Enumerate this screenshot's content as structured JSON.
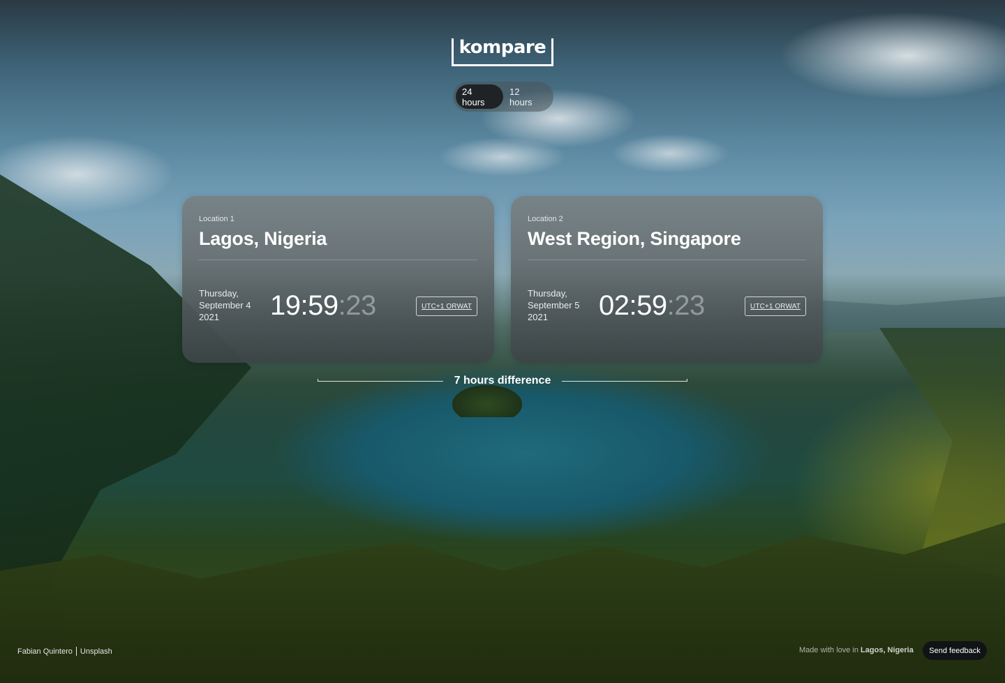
{
  "app": {
    "logo_text": "kompare"
  },
  "format_toggle": {
    "options": [
      "24 hours",
      "12 hours"
    ],
    "selected": "24 hours"
  },
  "locations": [
    {
      "label": "Location 1",
      "city": "Lagos, Nigeria",
      "date_line1": "Thursday,",
      "date_line2": "September 4",
      "date_line3": "2021",
      "time_hm": "19:59",
      "time_sep": ":",
      "time_sec": "23",
      "tz_prefix": "UTC+1 OR ",
      "tz_abbr": "WAT"
    },
    {
      "label": "Location 2",
      "city": "West Region, Singapore",
      "date_line1": "Thursday,",
      "date_line2": "September 5",
      "date_line3": "2021",
      "time_hm": "02:59",
      "time_sep": ":",
      "time_sec": "23",
      "tz_prefix": "UTC+1 OR ",
      "tz_abbr": "WAT"
    }
  ],
  "difference": {
    "text": "7 hours difference"
  },
  "footer": {
    "photographer": "Fabian Quintero",
    "source": "Unsplash",
    "made_prefix": "Made with love in ",
    "made_place": "Lagos, Nigeria",
    "feedback_label": "Send feedback"
  },
  "colors": {
    "toggle_active": "#1f2326",
    "feedback_bg": "#111416",
    "card_bg": "#6e7678"
  }
}
